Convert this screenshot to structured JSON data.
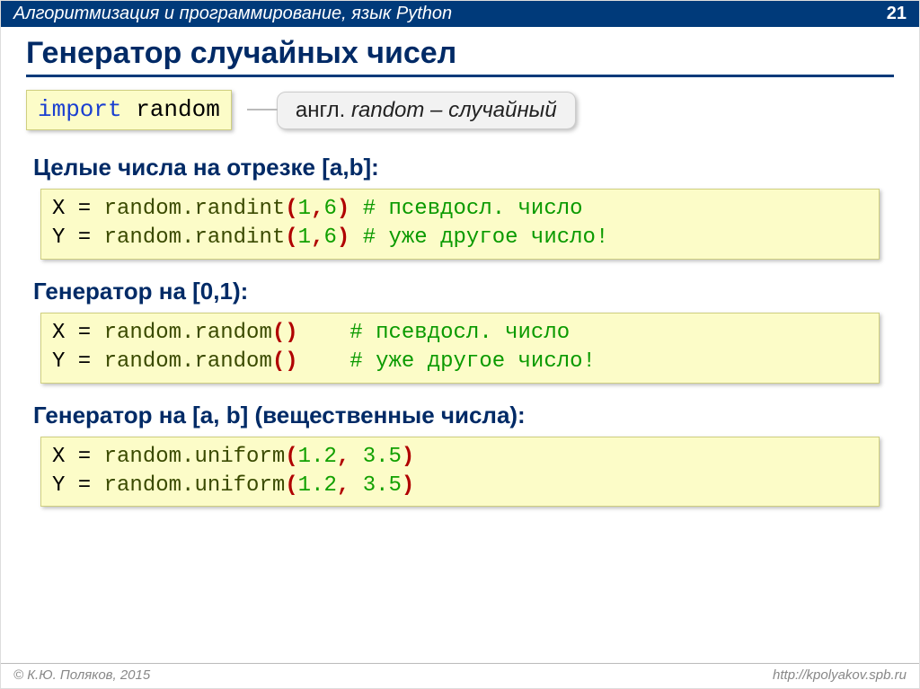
{
  "header": {
    "course": "Алгоритмизация и программирование, язык Python",
    "page": "21"
  },
  "title": "Генератор случайных чисел",
  "import_line": {
    "kw": "import",
    "mod": " random"
  },
  "callout": {
    "prefix": "англ. ",
    "word": "random",
    "suffix": " – случайный"
  },
  "sections": [
    {
      "heading": "Целые числа на отрезке [a,b]:",
      "lines": [
        {
          "var": "X",
          "eq": " = ",
          "call": "random.randint",
          "args": "(1,6)",
          "comment": " # псевдосл. число"
        },
        {
          "var": "Y",
          "eq": " = ",
          "call": "random.randint",
          "args": "(1,6)",
          "comment": " # уже другое число!"
        }
      ]
    },
    {
      "heading": "Генератор на [0,1):",
      "lines": [
        {
          "var": "X",
          "eq": " = ",
          "call": "random.random",
          "args": "()",
          "pad": "   ",
          "comment": " # псевдосл. число"
        },
        {
          "var": "Y",
          "eq": " = ",
          "call": "random.random",
          "args": "()",
          "pad": "   ",
          "comment": " # уже другое число!"
        }
      ]
    },
    {
      "heading": "Генератор на [a, b] (вещественные числа):",
      "lines": [
        {
          "var": "X",
          "eq": " = ",
          "call": "random.uniform",
          "args": "(1.2, 3.5)",
          "comment": ""
        },
        {
          "var": "Y",
          "eq": " = ",
          "call": "random.uniform",
          "args": "(1.2, 3.5)",
          "comment": ""
        }
      ]
    }
  ],
  "footer": {
    "copyright": "© К.Ю. Поляков, 2015",
    "url": "http://kpolyakov.spb.ru"
  }
}
